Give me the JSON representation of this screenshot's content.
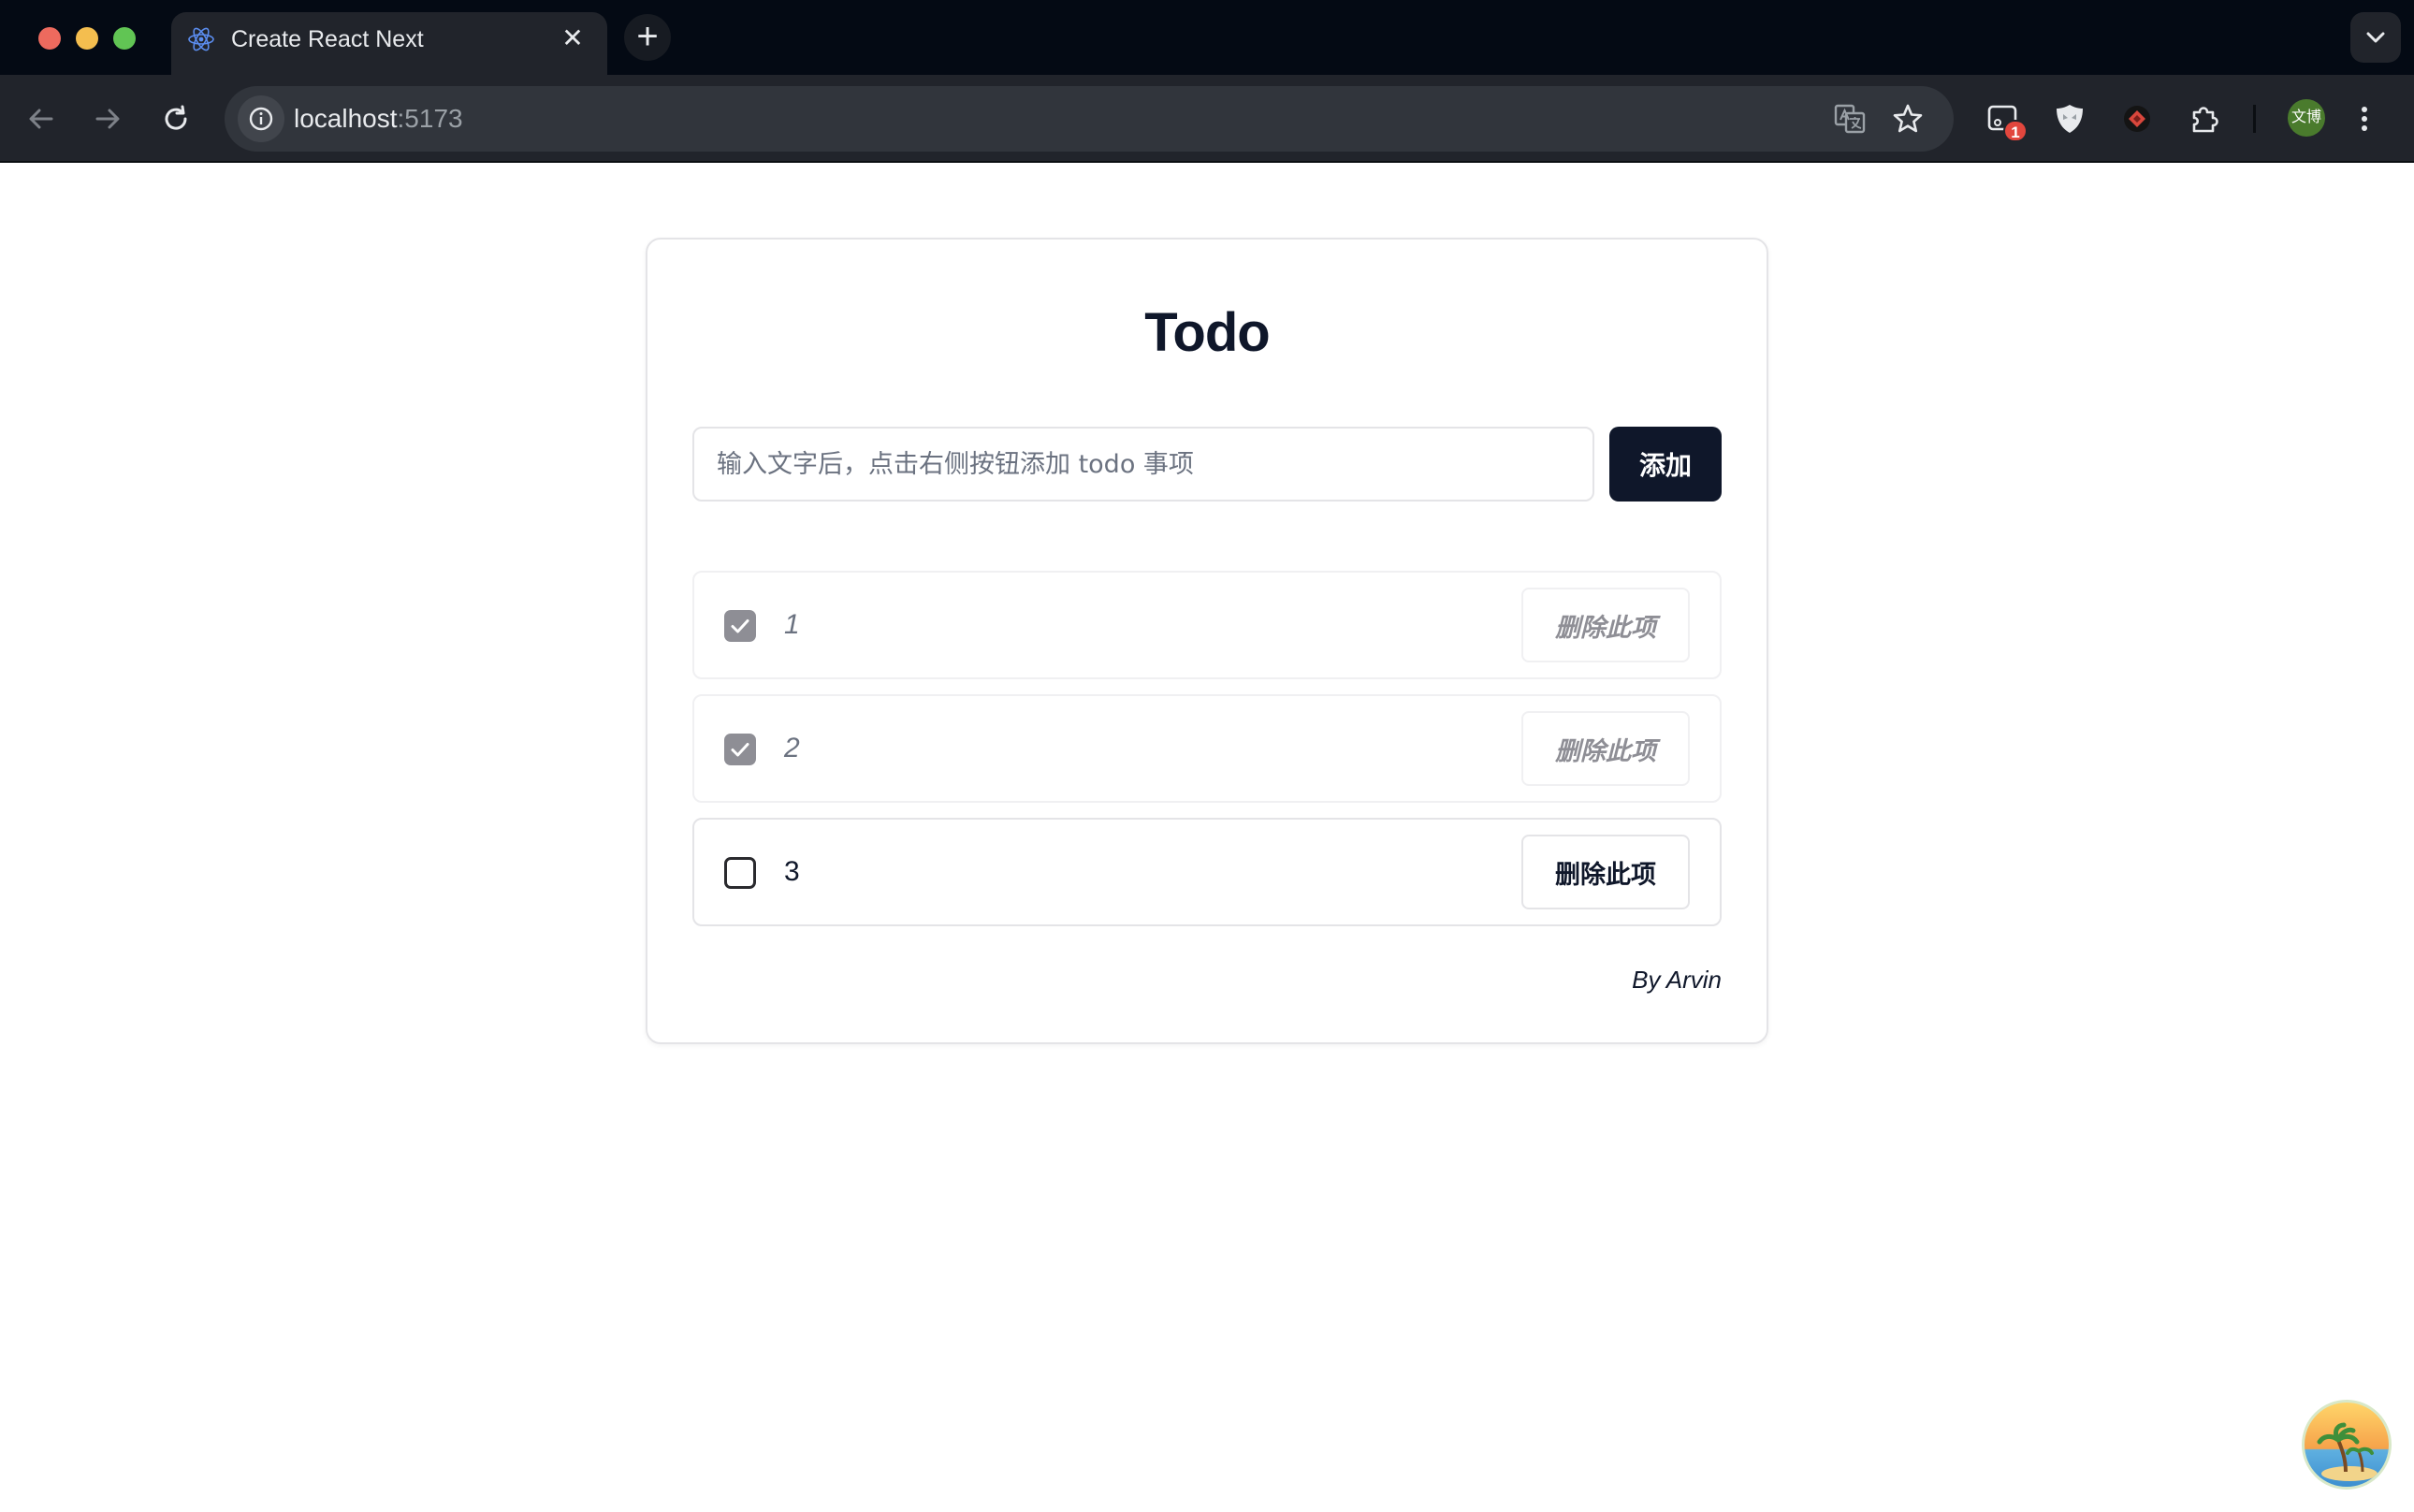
{
  "browser": {
    "tab_title": "Create React Next",
    "tab_close": "✕",
    "new_tab": "+",
    "url_host": "localhost",
    "url_port": ":5173",
    "extension_badge": "1",
    "profile_label": "文博"
  },
  "app": {
    "title": "Todo",
    "input_placeholder": "输入文字后，点击右侧按钮添加 todo 事项",
    "add_button": "添加",
    "items": [
      {
        "text": "1",
        "done": true,
        "delete_label": "删除此项"
      },
      {
        "text": "2",
        "done": true,
        "delete_label": "删除此项"
      },
      {
        "text": "3",
        "done": false,
        "delete_label": "删除此项"
      }
    ],
    "author": "By Arvin"
  }
}
